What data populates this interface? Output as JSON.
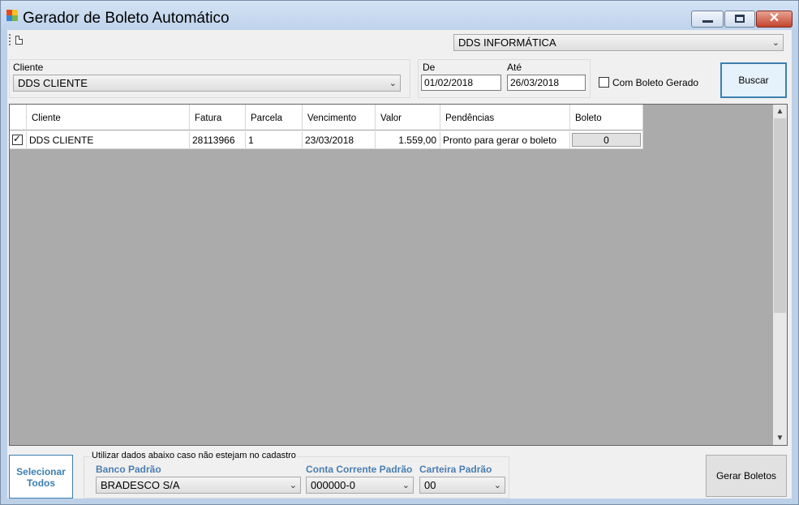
{
  "window": {
    "title": "Gerador de Boleto Automático",
    "close_glyph": "✕"
  },
  "icons": [
    "app-icon",
    "new-document-icon",
    "minimize-icon",
    "maximize-icon",
    "close-icon",
    "chevron-down-icon",
    "checkbox-checked-icon",
    "scroll-up-icon",
    "scroll-down-icon"
  ],
  "company_select": {
    "value": "DDS INFORMÁTICA"
  },
  "filters": {
    "cliente_label": "Cliente",
    "cliente_value": "DDS CLIENTE",
    "de_label": "De",
    "de_value": "01/02/2018",
    "ate_label": "Até",
    "ate_value": "26/03/2018",
    "com_boleto_label": "Com Boleto Gerado",
    "com_boleto_checked": false,
    "buscar_label": "Buscar"
  },
  "grid": {
    "columns": [
      "Cliente",
      "Fatura",
      "Parcela",
      "Vencimento",
      "Valor",
      "Pendências",
      "Boleto"
    ],
    "rows": [
      {
        "selected": true,
        "cliente": "DDS CLIENTE",
        "fatura": "28113966",
        "parcela": "1",
        "vencimento": "23/03/2018",
        "valor": "1.559,00",
        "pendencias": "Pronto para gerar o boleto",
        "boleto": "0"
      }
    ]
  },
  "bottom": {
    "select_all_label": "Selecionar Todos",
    "defaults_caption": "Utilizar dados abaixo caso não estejam no cadastro",
    "banco_label": "Banco Padrão",
    "banco_value": "BRADESCO S/A",
    "conta_label": "Conta Corrente Padrão",
    "conta_value": "000000-0",
    "carteira_label": "Carteira Padrão",
    "carteira_value": "00",
    "gerar_label": "Gerar Boletos"
  },
  "colors": {
    "accent": "#3c7fb1",
    "field_label": "#4a7eb0",
    "grid_background": "#ababab"
  }
}
